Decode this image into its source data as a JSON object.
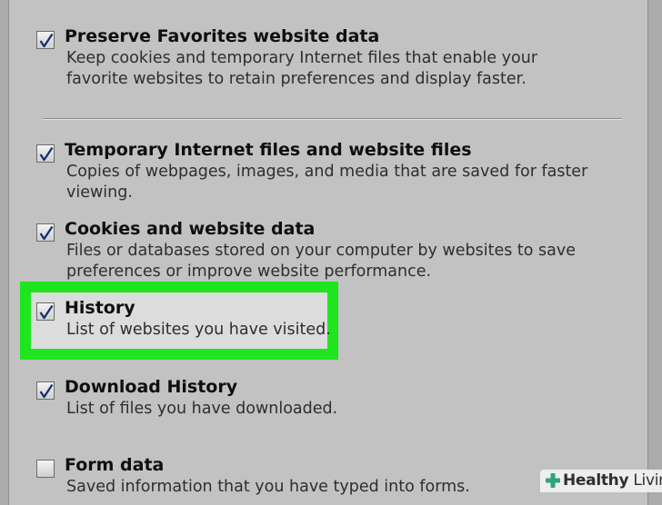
{
  "options": [
    {
      "title": "Preserve Favorites website data",
      "description": "Keep cookies and temporary Internet files that enable your favorite websites to retain preferences and display faster.",
      "checked": true
    },
    {
      "title": "Temporary Internet files and website files",
      "description": "Copies of webpages, images, and media that are saved for faster viewing.",
      "checked": true
    },
    {
      "title": "Cookies and website data",
      "description": "Files or databases stored on your computer by websites to save preferences or improve website performance.",
      "checked": true
    },
    {
      "title": "History",
      "description": "List of websites you have visited.",
      "checked": true,
      "highlighted": true
    },
    {
      "title": "Download History",
      "description": "List of files you have downloaded.",
      "checked": true
    },
    {
      "title": "Form data",
      "description": "Saved information that you have typed into forms.",
      "checked": false
    }
  ],
  "watermark": {
    "brand": "Healthy",
    "suffix": " Living"
  },
  "colors": {
    "highlight": "#1fe51f",
    "check": "#16306b",
    "background": "#c2c2c2"
  }
}
